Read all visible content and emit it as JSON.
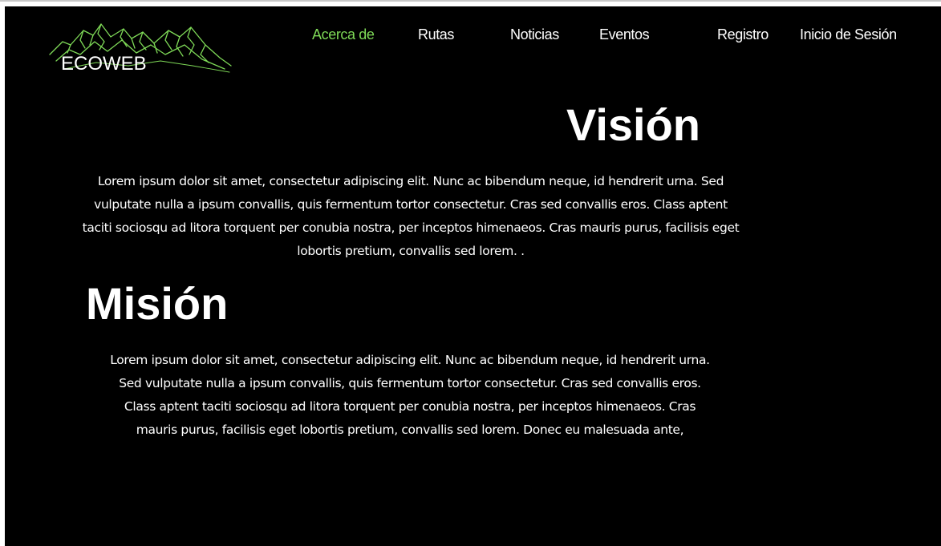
{
  "logo": {
    "text": "ECOWEB",
    "icon": "mountains-icon",
    "stroke_color": "#7ed957"
  },
  "nav": {
    "items": [
      {
        "label": "Acerca de",
        "active": true
      },
      {
        "label": "Rutas",
        "active": false
      },
      {
        "label": "Noticias",
        "active": false
      },
      {
        "label": "Eventos",
        "active": false
      },
      {
        "label": "Registro",
        "active": false
      },
      {
        "label": "Inicio de Sesión",
        "active": false
      }
    ]
  },
  "vision": {
    "title": "Visión",
    "text": "Lorem ipsum dolor sit amet, consectetur adipiscing elit. Nunc ac bibendum neque, id hendrerit urna. Sed vulputate nulla a ipsum convallis, quis fermentum tortor consectetur. Cras sed convallis eros. Class aptent taciti sociosqu ad litora torquent per conubia nostra, per inceptos himenaeos. Cras mauris purus, facilisis eget lobortis pretium, convallis sed lorem. ."
  },
  "mision": {
    "title": "Misión",
    "text": "Lorem ipsum dolor sit amet, consectetur adipiscing elit. Nunc ac bibendum neque, id hendrerit urna. Sed vulputate nulla a ipsum convallis, quis fermentum tortor consectetur. Cras sed convallis eros. Class aptent taciti sociosqu ad litora torquent per conubia nostra, per inceptos himenaeos. Cras mauris purus, facilisis eget lobortis pretium, convallis sed lorem. Donec eu malesuada ante,"
  },
  "colors": {
    "background": "#000000",
    "text": "#ffffff",
    "accent": "#7ed957"
  }
}
